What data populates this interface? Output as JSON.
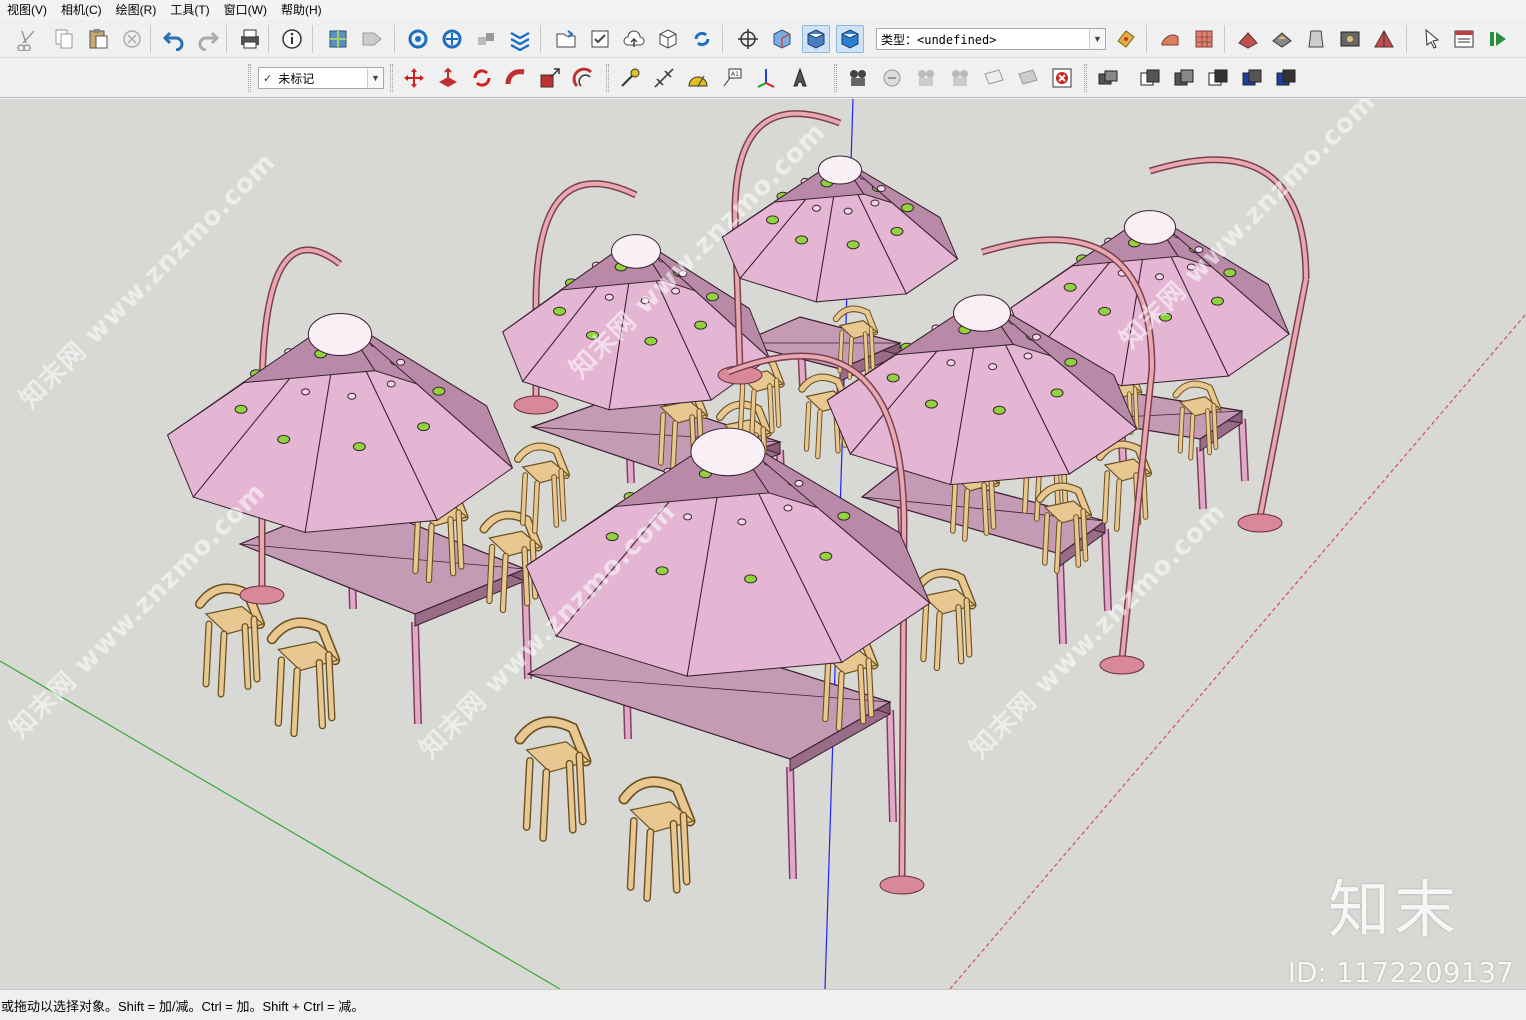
{
  "menu": [
    "视图(V)",
    "相机(C)",
    "绘图(R)",
    "工具(T)",
    "窗口(W)",
    "帮助(H)"
  ],
  "toolbar": {
    "type_combo_value": "类型：<undefined>",
    "tag_combo_value": "未标记"
  },
  "viewport": {
    "watermark_text": "知末网 www.znzmo.com",
    "logo_text": "知末",
    "id_text": "ID: 1172209137",
    "colors": {
      "background": "#d8d8d4",
      "canopy": "#e4b6d4",
      "canopy_dark": "#b88aa8",
      "table": "#c49ab4",
      "chair": "#e8c890",
      "hole": "#8fd43c",
      "pole": "#e8a8b0",
      "axis_blue": "#2020ff",
      "axis_green": "#3aa83a",
      "axis_red": "#d05050"
    }
  },
  "status": {
    "text": "或拖动以选择对象。Shift = 加/减。Ctrl = 加。Shift + Ctrl = 减。"
  }
}
